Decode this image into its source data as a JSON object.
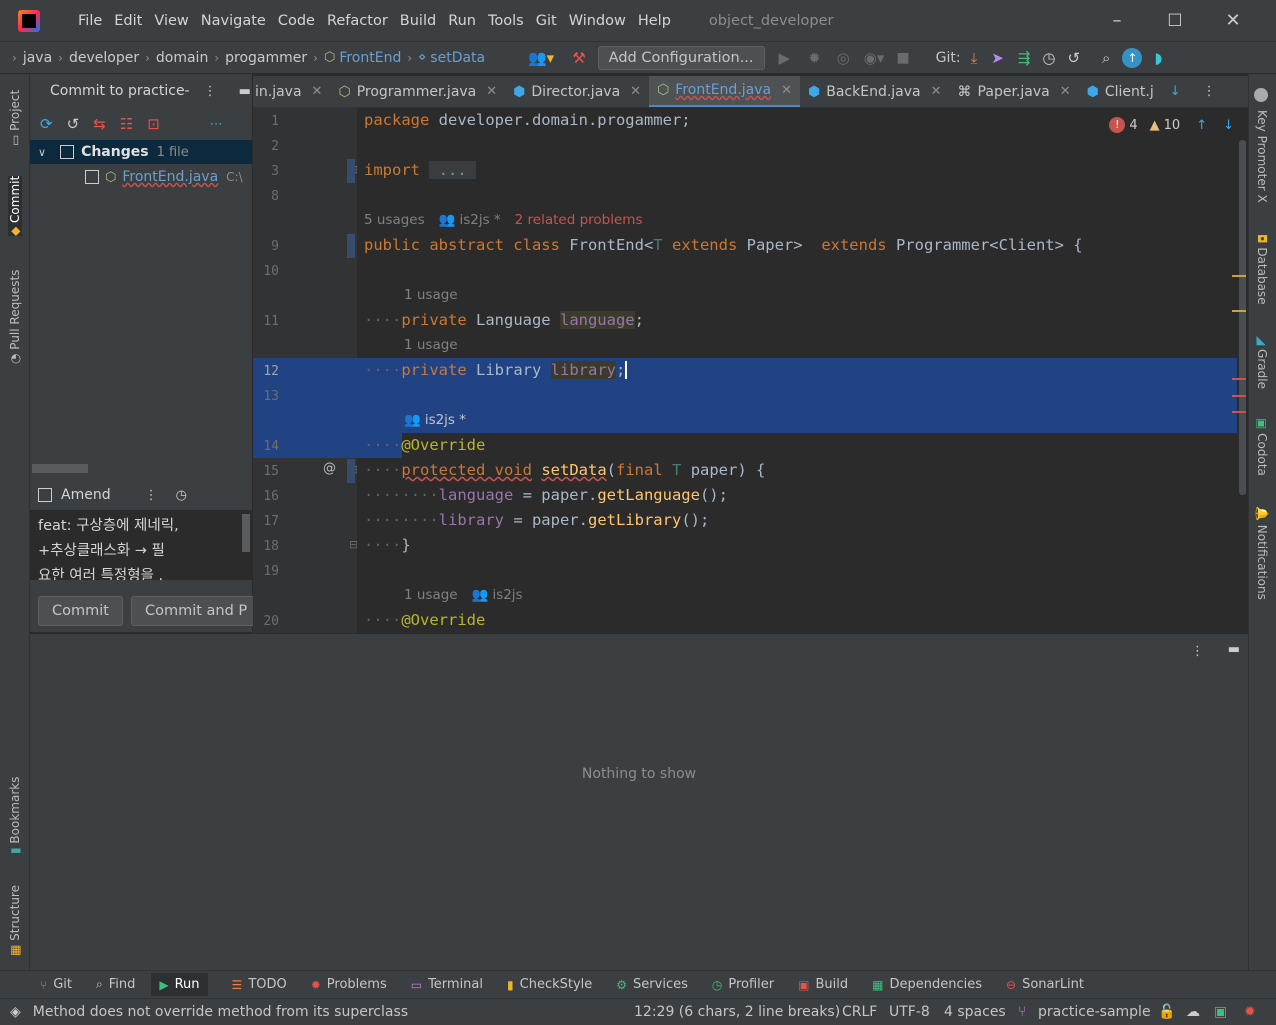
{
  "menu": [
    "File",
    "Edit",
    "View",
    "Navigate",
    "Code",
    "Refactor",
    "Build",
    "Run",
    "Tools",
    "Git",
    "Window",
    "Help"
  ],
  "window_title": "object_developer",
  "breadcrumb": [
    "java",
    "developer",
    "domain",
    "progammer",
    "FrontEnd",
    "setData"
  ],
  "run_config": "Add Configuration...",
  "git_label": "Git:",
  "left_tabs": {
    "project": "Project",
    "commit": "Commit",
    "pull_requests": "Pull Requests",
    "bookmarks": "Bookmarks",
    "structure": "Structure"
  },
  "right_tabs": {
    "key_promoter": "Key Promoter X",
    "database": "Database",
    "gradle": "Gradle",
    "codota": "Codota",
    "notifications": "Notifications"
  },
  "commit_panel": {
    "title": "Commit to practice-",
    "changes_label": "Changes",
    "changes_count": "1 file",
    "file_name": "FrontEnd.java",
    "file_path": "C:\\",
    "amend": "Amend",
    "message_lines": [
      "feat: 구상층에 제네릭,",
      "+추상클래스화 → 필",
      "요한 여러 특정형을 ."
    ],
    "commit_btn": "Commit",
    "commit_push_btn": "Commit and P"
  },
  "tabs": [
    {
      "label": "in.java",
      "active": false
    },
    {
      "label": "Programmer.java",
      "active": false
    },
    {
      "label": "Director.java",
      "active": false
    },
    {
      "label": "FrontEnd.java",
      "active": true
    },
    {
      "label": "BackEnd.java",
      "active": false
    },
    {
      "label": "Paper.java",
      "active": false
    },
    {
      "label": "Client.j",
      "active": false
    }
  ],
  "inspections": {
    "errors": "4",
    "warnings": "10"
  },
  "line_numbers": [
    "1",
    "2",
    "3",
    "8",
    "9",
    "10",
    "11",
    "12",
    "13",
    "14",
    "15",
    "16",
    "17",
    "18",
    "19",
    "20"
  ],
  "hints": {
    "usages5": "5 usages",
    "author1": "is2js *",
    "problems": "2 related problems",
    "usage1a": "1 usage",
    "usage1b": "1 usage",
    "author2": "is2js *",
    "usage1c": "1 usage",
    "author3": "is2js"
  },
  "bottom_panel": {
    "empty": "Nothing to show"
  },
  "tool_windows": [
    "Git",
    "Find",
    "Run",
    "TODO",
    "Problems",
    "Terminal",
    "CheckStyle",
    "Services",
    "Profiler",
    "Build",
    "Dependencies",
    "SonarLint"
  ],
  "status": {
    "message": "Method does not override method from its superclass",
    "position": "12:29 (6 chars, 2 line breaks)",
    "line_sep": "CRLF",
    "encoding": "UTF-8",
    "indent": "4 spaces",
    "branch": "practice-sample"
  },
  "colors": {
    "accent": "#4a88c7",
    "selection": "#214283",
    "keyword": "#cc7832",
    "field": "#9876aa",
    "error": "#c75450",
    "warning": "#e5c07b"
  }
}
